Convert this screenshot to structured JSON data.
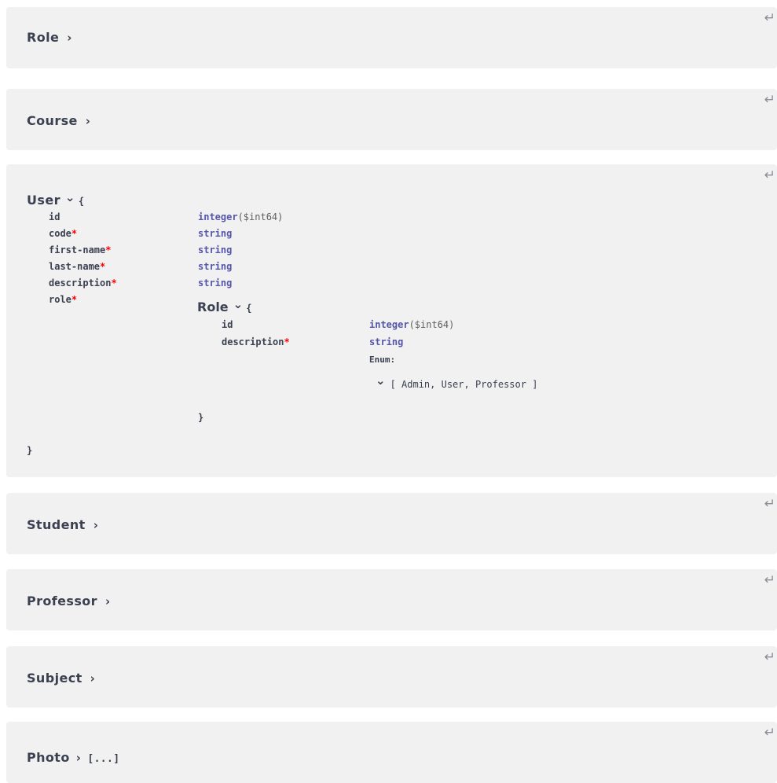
{
  "collapse_glyph": "↵",
  "required_marker": "*",
  "models": [
    {
      "name": "Role",
      "state": "collapsed",
      "suffix": ""
    },
    {
      "name": "Course",
      "state": "collapsed",
      "suffix": ""
    },
    {
      "name": "User",
      "state": "expanded",
      "suffix": ""
    },
    {
      "name": "Student",
      "state": "collapsed",
      "suffix": ""
    },
    {
      "name": "Professor",
      "state": "collapsed",
      "suffix": ""
    },
    {
      "name": "Subject",
      "state": "collapsed",
      "suffix": ""
    },
    {
      "name": "Photo",
      "state": "collapsed",
      "suffix": "[...]"
    }
  ],
  "chevron_right": "›",
  "chevron_down": "⌄",
  "open_brace": "{",
  "close_brace": "}",
  "user_model": {
    "properties": [
      {
        "name": "id",
        "required": false,
        "type": "integer",
        "format": "($int64)"
      },
      {
        "name": "code",
        "required": true,
        "type": "string",
        "format": ""
      },
      {
        "name": "first-name",
        "required": true,
        "type": "string",
        "format": ""
      },
      {
        "name": "last-name",
        "required": true,
        "type": "string",
        "format": ""
      },
      {
        "name": "description",
        "required": true,
        "type": "string",
        "format": ""
      },
      {
        "name": "role",
        "required": true,
        "type": "Role",
        "format": ""
      }
    ],
    "role_model": {
      "title": "Role",
      "properties": [
        {
          "name": "id",
          "required": false,
          "type": "integer",
          "format": "($int64)"
        },
        {
          "name": "description",
          "required": true,
          "type": "string",
          "format": ""
        }
      ],
      "enum_label": "Enum:",
      "enum_values": "[ Admin, User, Professor ]"
    }
  },
  "colors": {
    "panel_bg": "#f1f1f1",
    "text": "#3b4151",
    "type": "#5555aa",
    "required": "#ff0000"
  }
}
